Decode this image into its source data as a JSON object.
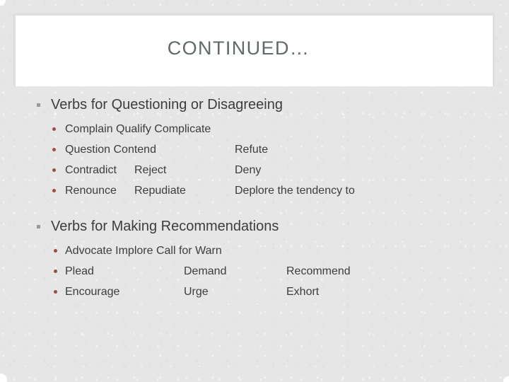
{
  "slide": {
    "title": "CONTINUED…",
    "title_color": "#5f6b64",
    "background_color": "#e6e6e6",
    "heading_color": "#3d3d3d",
    "level1_bullet_color": "#9a9a9a",
    "level2_bullet_color": "#9d4c42",
    "sections": [
      {
        "heading": "Verbs for Questioning or Disagreeing",
        "rows": [
          {
            "layout": "inline",
            "inline_text": "Complain  Qualify  Complicate"
          },
          {
            "layout": "columns",
            "cells": [
              "Question  Contend",
              "",
              "Refute"
            ]
          },
          {
            "layout": "columns",
            "cells": [
              "Contradict",
              "Reject",
              "Deny"
            ]
          },
          {
            "layout": "columns",
            "cells": [
              "Renounce",
              "Repudiate",
              "Deplore the tendency to"
            ]
          }
        ]
      },
      {
        "heading": "Verbs for Making Recommendations",
        "rows": [
          {
            "layout": "inline",
            "inline_text": "Advocate  Implore Call for  Warn"
          },
          {
            "layout": "columns",
            "cells": [
              "Plead",
              "Demand",
              "Recommend"
            ]
          },
          {
            "layout": "columns",
            "cells": [
              "Encourage",
              "Urge",
              "Exhort"
            ]
          }
        ]
      }
    ]
  }
}
